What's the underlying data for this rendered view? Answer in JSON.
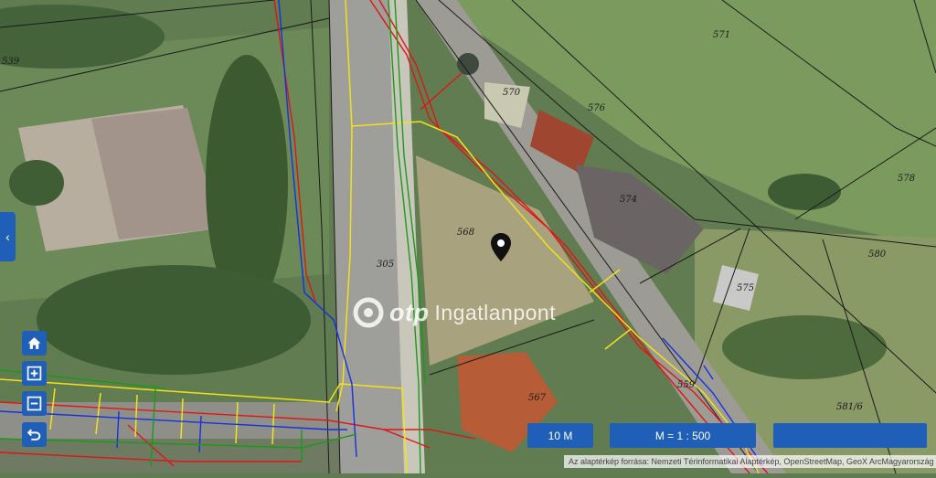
{
  "map": {
    "parcels": [
      "571",
      "539",
      "570",
      "576",
      "578",
      "574",
      "568",
      "305",
      "580",
      "575",
      "567",
      "559",
      "581/6"
    ],
    "watermark": {
      "brand": "otp",
      "name": "Ingatlanpont"
    }
  },
  "controls": {
    "side_toggle_icon": "chevron-left-icon",
    "home_icon": "home-icon",
    "zoom_in_icon": "plus-square-icon",
    "zoom_out_icon": "minus-square-icon",
    "back_icon": "undo-icon"
  },
  "scale": {
    "bar_label": "10 M",
    "ratio_label": "M = 1 : 500"
  },
  "attribution": "Az alaptérkép forrása: Nemzeti Térinformatikai Alaptérkép, OpenStreetMap, GeoX ArcMagyarország",
  "colors": {
    "control_blue": "#1f5fb8",
    "line_red": "#e01515",
    "line_yellow": "#f2e21a",
    "line_blue": "#1630e0",
    "line_green": "#1a9a1a"
  }
}
